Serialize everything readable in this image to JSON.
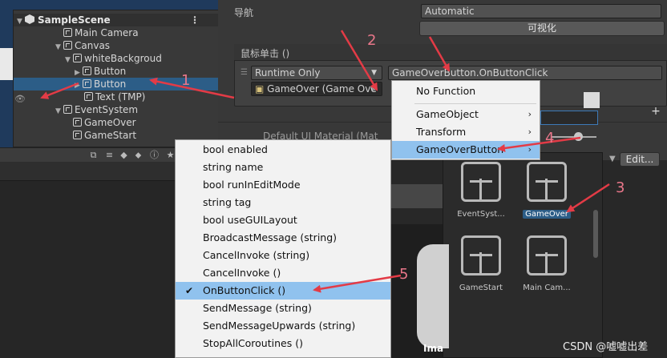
{
  "hierarchy": {
    "scene": "SampleScene",
    "items": [
      {
        "label": "Main Camera"
      },
      {
        "label": "Canvas"
      },
      {
        "label": "whiteBackgroud"
      },
      {
        "label": "Button"
      },
      {
        "label": "Button"
      },
      {
        "label": "Text (TMP)"
      },
      {
        "label": "EventSystem"
      },
      {
        "label": "GameOver"
      },
      {
        "label": "GameStart"
      }
    ]
  },
  "inspector": {
    "nav_label": "导航",
    "nav_value": "Automatic",
    "visualize_button": "可视化",
    "event_header": "鼠标单击 ()",
    "runtime_option": "Runtime Only",
    "function_value": "GameOverButton.OnButtonClick",
    "object_value": "GameOver (Game Ove",
    "default_material": "Default UI Material (Mat",
    "edit_button": "Edit...",
    "add_button": "+"
  },
  "menu_functions": {
    "items": [
      {
        "label": "No Function",
        "submenu": false
      },
      {
        "label": "GameObject",
        "submenu": true
      },
      {
        "label": "Transform",
        "submenu": true
      },
      {
        "label": "GameOverButton",
        "submenu": true
      }
    ]
  },
  "menu_members": {
    "items": [
      {
        "label": "bool enabled"
      },
      {
        "label": "string name"
      },
      {
        "label": "bool runInEditMode"
      },
      {
        "label": "string tag"
      },
      {
        "label": "bool useGUILayout"
      },
      {
        "label": "BroadcastMessage (string)"
      },
      {
        "label": "CancelInvoke (string)"
      },
      {
        "label": "CancelInvoke ()"
      },
      {
        "label": "OnButtonClick ()",
        "checked": true
      },
      {
        "label": "SendMessage (string)"
      },
      {
        "label": "SendMessageUpwards (string)"
      },
      {
        "label": "StopAllCoroutines ()"
      }
    ]
  },
  "picker": {
    "items": [
      {
        "label": "EventSyst..."
      },
      {
        "label": "GameOver"
      },
      {
        "label": "GameStart"
      },
      {
        "label": "Main Cam..."
      }
    ]
  },
  "preview_label": "Ima",
  "watermark": "CSDN @嘘嘘出差",
  "annotations": [
    "1",
    "2",
    "3",
    "4",
    "5"
  ],
  "colors": {
    "annotation": "#e33b46",
    "selection": "#2c5d87",
    "menu_highlight": "#90c2ee"
  }
}
